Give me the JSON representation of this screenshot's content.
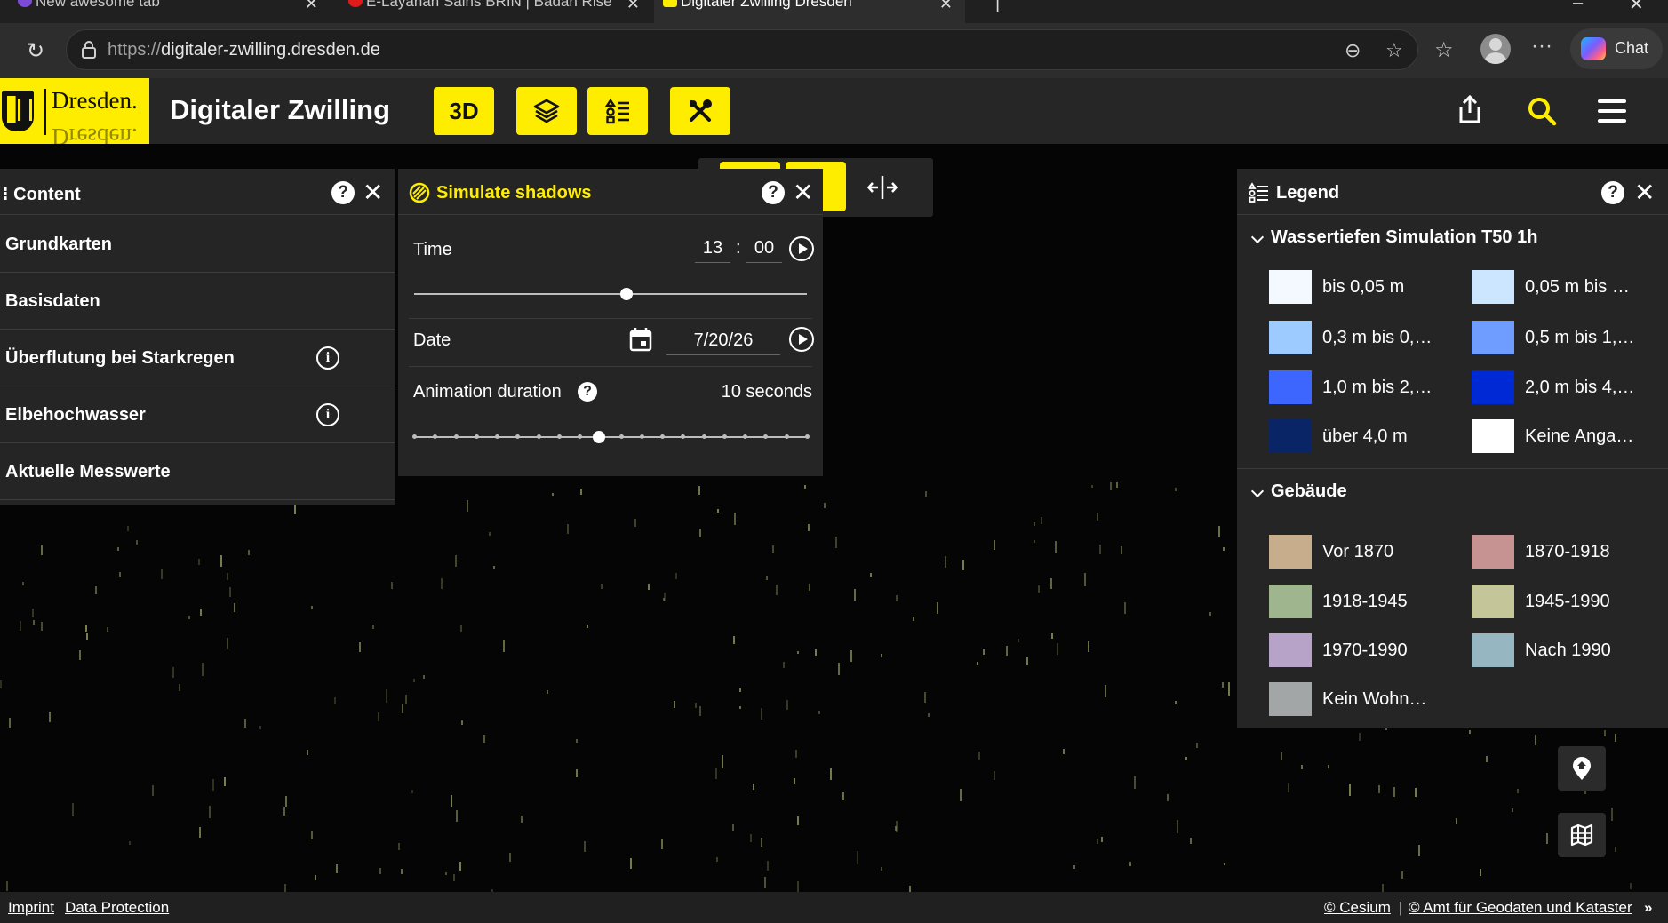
{
  "browser": {
    "tabs": [
      {
        "title": "New awesome tab",
        "active": false
      },
      {
        "title": "E-Layanan Sains BRIN | Badan Rise",
        "active": false
      },
      {
        "title": "Digitaler Zwilling Dresden",
        "active": true
      }
    ],
    "url_scheme": "https://",
    "url_host": "digitaler-zwilling.dresden.de",
    "chat_label": "Chat"
  },
  "app": {
    "logo_text": "Dresden.",
    "title": "Digitaler Zwilling",
    "btn_3d_label": "3D"
  },
  "content_panel": {
    "title": "Content",
    "items": [
      {
        "label": "Grundkarten",
        "info": false
      },
      {
        "label": "Basisdaten",
        "info": false
      },
      {
        "label": "Überflutung bei Starkregen",
        "info": true
      },
      {
        "label": "Elbehochwasser",
        "info": true
      },
      {
        "label": "Aktuelle Messwerte",
        "info": false
      }
    ]
  },
  "shadow_panel": {
    "title": "Simulate shadows",
    "time_label": "Time",
    "hour": "13",
    "colon": ":",
    "minute": "00",
    "time_fraction": 0.54,
    "date_label": "Date",
    "date_value": "7/20/26",
    "duration_label": "Animation duration",
    "duration_value": "10 seconds",
    "duration_fraction": 0.47
  },
  "legend": {
    "title": "Legend",
    "sections": [
      {
        "title": "Wassertiefen Simulation T50 1h",
        "items": [
          {
            "label": "bis 0,05 m",
            "color": "#f4f8ff"
          },
          {
            "label": "0,05 m bis …",
            "color": "#cce6ff"
          },
          {
            "label": "0,3 m bis 0,…",
            "color": "#9ecbff"
          },
          {
            "label": "0,5 m bis 1,…",
            "color": "#6f9cff"
          },
          {
            "label": "1,0 m bis 2,…",
            "color": "#3d66ff"
          },
          {
            "label": "2,0 m bis 4,…",
            "color": "#0029d6"
          },
          {
            "label": "über 4,0 m",
            "color": "#0a2566"
          },
          {
            "label": "Keine Anga…",
            "color": "#ffffff"
          }
        ]
      },
      {
        "title": "Gebäude",
        "items": [
          {
            "label": "Vor 1870",
            "color": "#c8ad8d"
          },
          {
            "label": "1870-1918",
            "color": "#c79292"
          },
          {
            "label": "1918-1945",
            "color": "#9fb58e"
          },
          {
            "label": "1945-1990",
            "color": "#c5c59a"
          },
          {
            "label": "1970-1990",
            "color": "#b8a3c8"
          },
          {
            "label": "Nach 1990",
            "color": "#96b6c2"
          },
          {
            "label": "Kein Wohn…",
            "color": "#a3a6a6"
          }
        ]
      }
    ]
  },
  "footer": {
    "imprint": "Imprint",
    "data_protection": "Data Protection",
    "cesium": "© Cesium",
    "separator": "|",
    "amt": "© Amt für Geodaten und Kataster",
    "more": "»"
  },
  "colors": {
    "accent": "#ffed00",
    "panel": "#252525",
    "header": "#262626"
  }
}
